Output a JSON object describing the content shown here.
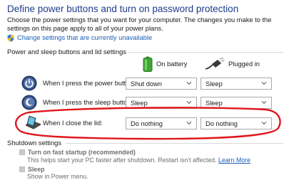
{
  "page": {
    "title": "Define power buttons and turn on password protection",
    "description": "Choose the power settings that you want for your computer. The changes you make to the settings on this page apply to all of your power plans.",
    "change_link": "Change settings that are currently unavailable"
  },
  "buttons_group": {
    "label": "Power and sleep buttons and lid settings",
    "col_battery": "On battery",
    "col_plugged": "Plugged in",
    "rows": [
      {
        "label": "When I press the power button:",
        "battery": "Shut down",
        "plugged": "Sleep"
      },
      {
        "label": "When I press the sleep button:",
        "battery": "Sleep",
        "plugged": "Sleep"
      },
      {
        "label": "When I close the lid:",
        "battery": "Do nothing",
        "plugged": "Do nothing"
      }
    ]
  },
  "shutdown_group": {
    "label": "Shutdown settings",
    "fast_startup": {
      "label": "Turn on fast startup (recommended)",
      "desc": "This helps start your PC faster after shutdown. Restart isn't affected.",
      "learn_more": "Learn More"
    },
    "sleep": {
      "label": "Sleep",
      "desc": "Show in Power menu."
    }
  },
  "colors": {
    "title": "#1e3c8c",
    "link": "#1a5fb4",
    "annotation": "#e0161b",
    "disabled_text": "#6e6e6e"
  },
  "icons": {
    "shield": "uac-shield-icon",
    "battery": "battery-icon",
    "plug": "power-plug-icon",
    "power_button": "power-button-icon",
    "sleep_button": "sleep-button-icon",
    "lid": "laptop-lid-icon"
  }
}
